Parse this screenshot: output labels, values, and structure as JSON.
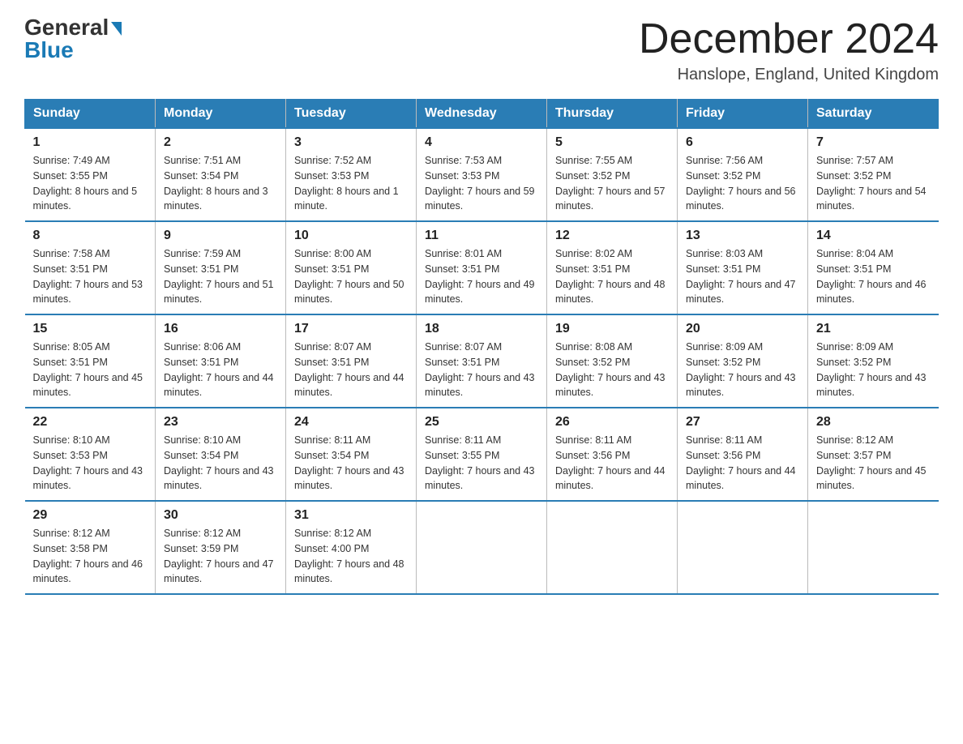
{
  "header": {
    "logo_line1": "General",
    "logo_line2": "Blue",
    "month_title": "December 2024",
    "location": "Hanslope, England, United Kingdom"
  },
  "days_of_week": [
    "Sunday",
    "Monday",
    "Tuesday",
    "Wednesday",
    "Thursday",
    "Friday",
    "Saturday"
  ],
  "weeks": [
    [
      {
        "day": "1",
        "sunrise": "7:49 AM",
        "sunset": "3:55 PM",
        "daylight": "8 hours and 5 minutes."
      },
      {
        "day": "2",
        "sunrise": "7:51 AM",
        "sunset": "3:54 PM",
        "daylight": "8 hours and 3 minutes."
      },
      {
        "day": "3",
        "sunrise": "7:52 AM",
        "sunset": "3:53 PM",
        "daylight": "8 hours and 1 minute."
      },
      {
        "day": "4",
        "sunrise": "7:53 AM",
        "sunset": "3:53 PM",
        "daylight": "7 hours and 59 minutes."
      },
      {
        "day": "5",
        "sunrise": "7:55 AM",
        "sunset": "3:52 PM",
        "daylight": "7 hours and 57 minutes."
      },
      {
        "day": "6",
        "sunrise": "7:56 AM",
        "sunset": "3:52 PM",
        "daylight": "7 hours and 56 minutes."
      },
      {
        "day": "7",
        "sunrise": "7:57 AM",
        "sunset": "3:52 PM",
        "daylight": "7 hours and 54 minutes."
      }
    ],
    [
      {
        "day": "8",
        "sunrise": "7:58 AM",
        "sunset": "3:51 PM",
        "daylight": "7 hours and 53 minutes."
      },
      {
        "day": "9",
        "sunrise": "7:59 AM",
        "sunset": "3:51 PM",
        "daylight": "7 hours and 51 minutes."
      },
      {
        "day": "10",
        "sunrise": "8:00 AM",
        "sunset": "3:51 PM",
        "daylight": "7 hours and 50 minutes."
      },
      {
        "day": "11",
        "sunrise": "8:01 AM",
        "sunset": "3:51 PM",
        "daylight": "7 hours and 49 minutes."
      },
      {
        "day": "12",
        "sunrise": "8:02 AM",
        "sunset": "3:51 PM",
        "daylight": "7 hours and 48 minutes."
      },
      {
        "day": "13",
        "sunrise": "8:03 AM",
        "sunset": "3:51 PM",
        "daylight": "7 hours and 47 minutes."
      },
      {
        "day": "14",
        "sunrise": "8:04 AM",
        "sunset": "3:51 PM",
        "daylight": "7 hours and 46 minutes."
      }
    ],
    [
      {
        "day": "15",
        "sunrise": "8:05 AM",
        "sunset": "3:51 PM",
        "daylight": "7 hours and 45 minutes."
      },
      {
        "day": "16",
        "sunrise": "8:06 AM",
        "sunset": "3:51 PM",
        "daylight": "7 hours and 44 minutes."
      },
      {
        "day": "17",
        "sunrise": "8:07 AM",
        "sunset": "3:51 PM",
        "daylight": "7 hours and 44 minutes."
      },
      {
        "day": "18",
        "sunrise": "8:07 AM",
        "sunset": "3:51 PM",
        "daylight": "7 hours and 43 minutes."
      },
      {
        "day": "19",
        "sunrise": "8:08 AM",
        "sunset": "3:52 PM",
        "daylight": "7 hours and 43 minutes."
      },
      {
        "day": "20",
        "sunrise": "8:09 AM",
        "sunset": "3:52 PM",
        "daylight": "7 hours and 43 minutes."
      },
      {
        "day": "21",
        "sunrise": "8:09 AM",
        "sunset": "3:52 PM",
        "daylight": "7 hours and 43 minutes."
      }
    ],
    [
      {
        "day": "22",
        "sunrise": "8:10 AM",
        "sunset": "3:53 PM",
        "daylight": "7 hours and 43 minutes."
      },
      {
        "day": "23",
        "sunrise": "8:10 AM",
        "sunset": "3:54 PM",
        "daylight": "7 hours and 43 minutes."
      },
      {
        "day": "24",
        "sunrise": "8:11 AM",
        "sunset": "3:54 PM",
        "daylight": "7 hours and 43 minutes."
      },
      {
        "day": "25",
        "sunrise": "8:11 AM",
        "sunset": "3:55 PM",
        "daylight": "7 hours and 43 minutes."
      },
      {
        "day": "26",
        "sunrise": "8:11 AM",
        "sunset": "3:56 PM",
        "daylight": "7 hours and 44 minutes."
      },
      {
        "day": "27",
        "sunrise": "8:11 AM",
        "sunset": "3:56 PM",
        "daylight": "7 hours and 44 minutes."
      },
      {
        "day": "28",
        "sunrise": "8:12 AM",
        "sunset": "3:57 PM",
        "daylight": "7 hours and 45 minutes."
      }
    ],
    [
      {
        "day": "29",
        "sunrise": "8:12 AM",
        "sunset": "3:58 PM",
        "daylight": "7 hours and 46 minutes."
      },
      {
        "day": "30",
        "sunrise": "8:12 AM",
        "sunset": "3:59 PM",
        "daylight": "7 hours and 47 minutes."
      },
      {
        "day": "31",
        "sunrise": "8:12 AM",
        "sunset": "4:00 PM",
        "daylight": "7 hours and 48 minutes."
      },
      null,
      null,
      null,
      null
    ]
  ],
  "labels": {
    "sunrise_prefix": "Sunrise: ",
    "sunset_prefix": "Sunset: ",
    "daylight_prefix": "Daylight: "
  }
}
